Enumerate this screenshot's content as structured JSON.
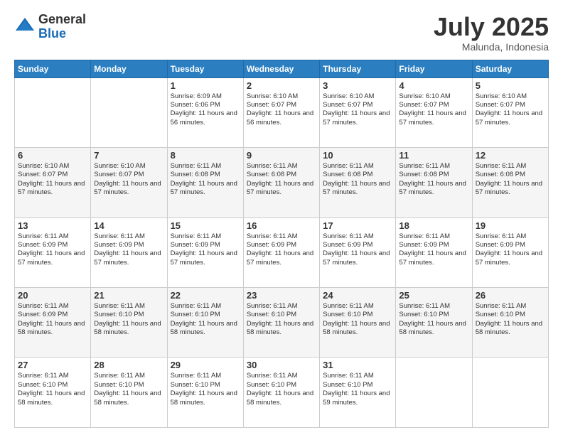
{
  "logo": {
    "general": "General",
    "blue": "Blue"
  },
  "title": "July 2025",
  "location": "Malunda, Indonesia",
  "days_of_week": [
    "Sunday",
    "Monday",
    "Tuesday",
    "Wednesday",
    "Thursday",
    "Friday",
    "Saturday"
  ],
  "weeks": [
    [
      {
        "day": "",
        "sunrise": "",
        "sunset": "",
        "daylight": ""
      },
      {
        "day": "",
        "sunrise": "",
        "sunset": "",
        "daylight": ""
      },
      {
        "day": "1",
        "sunrise": "Sunrise: 6:09 AM",
        "sunset": "Sunset: 6:06 PM",
        "daylight": "Daylight: 11 hours and 56 minutes."
      },
      {
        "day": "2",
        "sunrise": "Sunrise: 6:10 AM",
        "sunset": "Sunset: 6:07 PM",
        "daylight": "Daylight: 11 hours and 56 minutes."
      },
      {
        "day": "3",
        "sunrise": "Sunrise: 6:10 AM",
        "sunset": "Sunset: 6:07 PM",
        "daylight": "Daylight: 11 hours and 57 minutes."
      },
      {
        "day": "4",
        "sunrise": "Sunrise: 6:10 AM",
        "sunset": "Sunset: 6:07 PM",
        "daylight": "Daylight: 11 hours and 57 minutes."
      },
      {
        "day": "5",
        "sunrise": "Sunrise: 6:10 AM",
        "sunset": "Sunset: 6:07 PM",
        "daylight": "Daylight: 11 hours and 57 minutes."
      }
    ],
    [
      {
        "day": "6",
        "sunrise": "Sunrise: 6:10 AM",
        "sunset": "Sunset: 6:07 PM",
        "daylight": "Daylight: 11 hours and 57 minutes."
      },
      {
        "day": "7",
        "sunrise": "Sunrise: 6:10 AM",
        "sunset": "Sunset: 6:07 PM",
        "daylight": "Daylight: 11 hours and 57 minutes."
      },
      {
        "day": "8",
        "sunrise": "Sunrise: 6:11 AM",
        "sunset": "Sunset: 6:08 PM",
        "daylight": "Daylight: 11 hours and 57 minutes."
      },
      {
        "day": "9",
        "sunrise": "Sunrise: 6:11 AM",
        "sunset": "Sunset: 6:08 PM",
        "daylight": "Daylight: 11 hours and 57 minutes."
      },
      {
        "day": "10",
        "sunrise": "Sunrise: 6:11 AM",
        "sunset": "Sunset: 6:08 PM",
        "daylight": "Daylight: 11 hours and 57 minutes."
      },
      {
        "day": "11",
        "sunrise": "Sunrise: 6:11 AM",
        "sunset": "Sunset: 6:08 PM",
        "daylight": "Daylight: 11 hours and 57 minutes."
      },
      {
        "day": "12",
        "sunrise": "Sunrise: 6:11 AM",
        "sunset": "Sunset: 6:08 PM",
        "daylight": "Daylight: 11 hours and 57 minutes."
      }
    ],
    [
      {
        "day": "13",
        "sunrise": "Sunrise: 6:11 AM",
        "sunset": "Sunset: 6:09 PM",
        "daylight": "Daylight: 11 hours and 57 minutes."
      },
      {
        "day": "14",
        "sunrise": "Sunrise: 6:11 AM",
        "sunset": "Sunset: 6:09 PM",
        "daylight": "Daylight: 11 hours and 57 minutes."
      },
      {
        "day": "15",
        "sunrise": "Sunrise: 6:11 AM",
        "sunset": "Sunset: 6:09 PM",
        "daylight": "Daylight: 11 hours and 57 minutes."
      },
      {
        "day": "16",
        "sunrise": "Sunrise: 6:11 AM",
        "sunset": "Sunset: 6:09 PM",
        "daylight": "Daylight: 11 hours and 57 minutes."
      },
      {
        "day": "17",
        "sunrise": "Sunrise: 6:11 AM",
        "sunset": "Sunset: 6:09 PM",
        "daylight": "Daylight: 11 hours and 57 minutes."
      },
      {
        "day": "18",
        "sunrise": "Sunrise: 6:11 AM",
        "sunset": "Sunset: 6:09 PM",
        "daylight": "Daylight: 11 hours and 57 minutes."
      },
      {
        "day": "19",
        "sunrise": "Sunrise: 6:11 AM",
        "sunset": "Sunset: 6:09 PM",
        "daylight": "Daylight: 11 hours and 57 minutes."
      }
    ],
    [
      {
        "day": "20",
        "sunrise": "Sunrise: 6:11 AM",
        "sunset": "Sunset: 6:09 PM",
        "daylight": "Daylight: 11 hours and 58 minutes."
      },
      {
        "day": "21",
        "sunrise": "Sunrise: 6:11 AM",
        "sunset": "Sunset: 6:10 PM",
        "daylight": "Daylight: 11 hours and 58 minutes."
      },
      {
        "day": "22",
        "sunrise": "Sunrise: 6:11 AM",
        "sunset": "Sunset: 6:10 PM",
        "daylight": "Daylight: 11 hours and 58 minutes."
      },
      {
        "day": "23",
        "sunrise": "Sunrise: 6:11 AM",
        "sunset": "Sunset: 6:10 PM",
        "daylight": "Daylight: 11 hours and 58 minutes."
      },
      {
        "day": "24",
        "sunrise": "Sunrise: 6:11 AM",
        "sunset": "Sunset: 6:10 PM",
        "daylight": "Daylight: 11 hours and 58 minutes."
      },
      {
        "day": "25",
        "sunrise": "Sunrise: 6:11 AM",
        "sunset": "Sunset: 6:10 PM",
        "daylight": "Daylight: 11 hours and 58 minutes."
      },
      {
        "day": "26",
        "sunrise": "Sunrise: 6:11 AM",
        "sunset": "Sunset: 6:10 PM",
        "daylight": "Daylight: 11 hours and 58 minutes."
      }
    ],
    [
      {
        "day": "27",
        "sunrise": "Sunrise: 6:11 AM",
        "sunset": "Sunset: 6:10 PM",
        "daylight": "Daylight: 11 hours and 58 minutes."
      },
      {
        "day": "28",
        "sunrise": "Sunrise: 6:11 AM",
        "sunset": "Sunset: 6:10 PM",
        "daylight": "Daylight: 11 hours and 58 minutes."
      },
      {
        "day": "29",
        "sunrise": "Sunrise: 6:11 AM",
        "sunset": "Sunset: 6:10 PM",
        "daylight": "Daylight: 11 hours and 58 minutes."
      },
      {
        "day": "30",
        "sunrise": "Sunrise: 6:11 AM",
        "sunset": "Sunset: 6:10 PM",
        "daylight": "Daylight: 11 hours and 58 minutes."
      },
      {
        "day": "31",
        "sunrise": "Sunrise: 6:11 AM",
        "sunset": "Sunset: 6:10 PM",
        "daylight": "Daylight: 11 hours and 59 minutes."
      },
      {
        "day": "",
        "sunrise": "",
        "sunset": "",
        "daylight": ""
      },
      {
        "day": "",
        "sunrise": "",
        "sunset": "",
        "daylight": ""
      }
    ]
  ]
}
